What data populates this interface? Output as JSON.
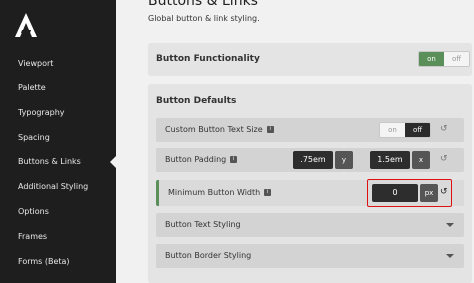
{
  "sidebar": {
    "items": [
      {
        "label": "Viewport"
      },
      {
        "label": "Palette"
      },
      {
        "label": "Typography"
      },
      {
        "label": "Spacing"
      },
      {
        "label": "Buttons & Links"
      },
      {
        "label": "Additional Styling"
      },
      {
        "label": "Options"
      },
      {
        "label": "Frames"
      },
      {
        "label": "Forms (Beta)"
      }
    ],
    "active_index": 4
  },
  "header": {
    "title": "Buttons & Links",
    "subtitle": "Global button & link styling."
  },
  "functionality": {
    "label": "Button Functionality",
    "on_label": "on",
    "off_label": "off",
    "selected": "on"
  },
  "defaults": {
    "label": "Button Defaults",
    "custom_text_size": {
      "label": "Custom Button Text Size",
      "on_label": "on",
      "off_label": "off",
      "selected": "off"
    },
    "padding": {
      "label": "Button Padding",
      "y_value": ".75em",
      "y_unit": "y",
      "x_value": "1.5em",
      "x_unit": "x"
    },
    "min_width": {
      "label": "Minimum Button Width",
      "value": "0",
      "unit": "px"
    },
    "text_styling": {
      "label": "Button Text Styling"
    },
    "border_styling": {
      "label": "Button Border Styling"
    }
  },
  "colors": {
    "accent_green": "#5a8f5a",
    "highlight_red": "#dd1111",
    "sidebar_bg": "#1e1e1e"
  }
}
